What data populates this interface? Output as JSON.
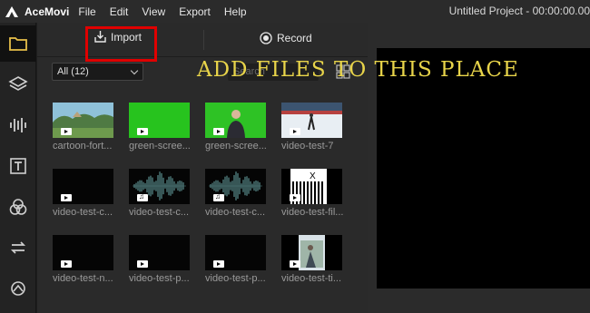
{
  "app": {
    "name": "AceMovi",
    "project_title": "Untitled Project - 00:00:00.00"
  },
  "menu": [
    "File",
    "Edit",
    "View",
    "Export",
    "Help"
  ],
  "sidebar": {
    "items": [
      {
        "icon": "folder-icon",
        "active": true
      },
      {
        "icon": "layers-icon"
      },
      {
        "icon": "audio-wave-icon"
      },
      {
        "icon": "text-icon"
      },
      {
        "icon": "filters-icon"
      },
      {
        "icon": "transitions-icon"
      },
      {
        "icon": "effects-icon"
      }
    ]
  },
  "media": {
    "import_label": "Import",
    "record_label": "Record",
    "filter_value": "All (12)",
    "search_placeholder": "Search",
    "items": [
      {
        "label": "cartoon-fort...",
        "type": "video",
        "thumb": "cartoon"
      },
      {
        "label": "green-scree...",
        "type": "video",
        "thumb": "green"
      },
      {
        "label": "green-scree...",
        "type": "video",
        "thumb": "green-person"
      },
      {
        "label": "video-test-7",
        "type": "video",
        "thumb": "skating"
      },
      {
        "label": "video-test-c...",
        "type": "video",
        "thumb": "black"
      },
      {
        "label": "video-test-c...",
        "type": "audio",
        "thumb": "wave"
      },
      {
        "label": "video-test-c...",
        "type": "audio",
        "thumb": "wave"
      },
      {
        "label": "video-test-fil...",
        "type": "video",
        "thumb": "stripes"
      },
      {
        "label": "video-test-n...",
        "type": "video",
        "thumb": "black"
      },
      {
        "label": "video-test-p...",
        "type": "video",
        "thumb": "black"
      },
      {
        "label": "video-test-p...",
        "type": "video",
        "thumb": "black"
      },
      {
        "label": "video-test-ti...",
        "type": "video",
        "thumb": "photo"
      }
    ]
  },
  "overlay": {
    "text": "ADD FILES TO THIS PLACE"
  },
  "colors": {
    "highlight": "#e00000",
    "overlay_text": "#e8d44a",
    "green_screen": "#27c31e"
  }
}
